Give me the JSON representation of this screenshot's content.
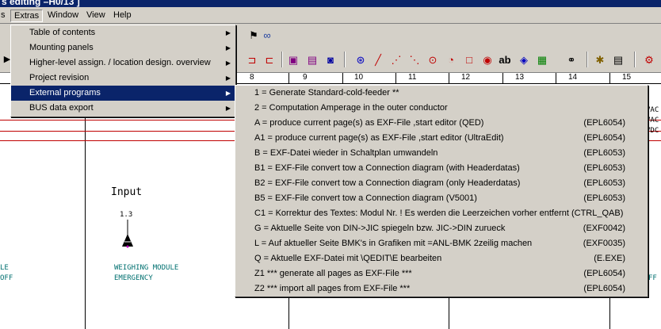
{
  "window": {
    "title": "s editing –H0/13   ]"
  },
  "menubar": {
    "items": [
      {
        "label": "s"
      },
      {
        "label": "Extras"
      },
      {
        "label": "Window"
      },
      {
        "label": "View"
      },
      {
        "label": "Help"
      }
    ]
  },
  "ruler": {
    "numbers": [
      "8",
      "9",
      "10",
      "11",
      "12",
      "13",
      "14",
      "15"
    ]
  },
  "drawing": {
    "input_label": "Input",
    "terminal_number": "1.3",
    "module_label_line1": "WEIGHING MODULE",
    "module_label_line2": "EMERGENCY",
    "left_text_line1": "LE",
    "left_text_line2": "OFF",
    "right_texts": [
      "VAC",
      "VAC",
      "VDC"
    ],
    "right_off": "FF"
  },
  "extras_menu": {
    "items": [
      {
        "label": "Table of contents",
        "has_submenu": true
      },
      {
        "label": "Mounting panels",
        "has_submenu": true
      },
      {
        "label": "Higher-level assign. / location design. overview",
        "has_submenu": true
      },
      {
        "label": "Project revision",
        "has_submenu": true
      },
      {
        "label": "External programs",
        "has_submenu": true,
        "selected": true
      },
      {
        "label": "BUS data export",
        "has_submenu": true
      }
    ]
  },
  "external_programs_menu": {
    "items": [
      {
        "label": "1 = Generate Standard-cold-feeder **",
        "code": ""
      },
      {
        "label": "2 = Computation Amperage in the outer conductor",
        "code": ""
      },
      {
        "label": "A = produce current page(s) as EXF-File ,start editor (QED)",
        "code": "(EPL6054)"
      },
      {
        "label": "A1 = produce current page(s) as EXF-File ,start editor (UltraEdit)",
        "code": "(EPL6054)"
      },
      {
        "label": "B = EXF-Datei wieder in Schaltplan umwandeln",
        "code": "(EPL6053)"
      },
      {
        "label": "B1 = EXF-File convert tow a Connection diagram (with Headerdatas)",
        "code": "(EPL6053)"
      },
      {
        "label": "B2 = EXF-File convert tow a Connection diagram (only Headerdatas)",
        "code": "(EPL6053)"
      },
      {
        "label": "B5 = EXF-File convert tow a Connection diagram (V5001)",
        "code": "(EPL6053)"
      },
      {
        "label": "C1 = Korrektur des Textes: Modul Nr. ! Es werden die Leerzeichen vorher entfernt (CTRL_QAB)",
        "code": ""
      },
      {
        "label": "G = Aktuelle Seite von DIN->JIC spiegeln bzw. JIC->DIN zurueck",
        "code": "(EXF0042)"
      },
      {
        "label": "L = Auf aktueller Seite BMK's in Grafiken mit =ANL-BMK 2zeilig machen",
        "code": "(EXF0035)"
      },
      {
        "label": "Q = Aktuelle EXF-Datei mit \\QEDIT\\E bearbeiten",
        "code": "(E.EXE)"
      },
      {
        "label": "Z1 *** generate all pages as EXF-File ***",
        "code": "(EPL6054)"
      },
      {
        "label": "Z2 *** import all pages from EXF-File ***",
        "code": "(EPL6054)"
      }
    ]
  },
  "colors": {
    "menu_bg": "#d4d0c8",
    "selection": "#0a246a",
    "schematic_line": "#c00000",
    "label_teal": "#007070"
  }
}
